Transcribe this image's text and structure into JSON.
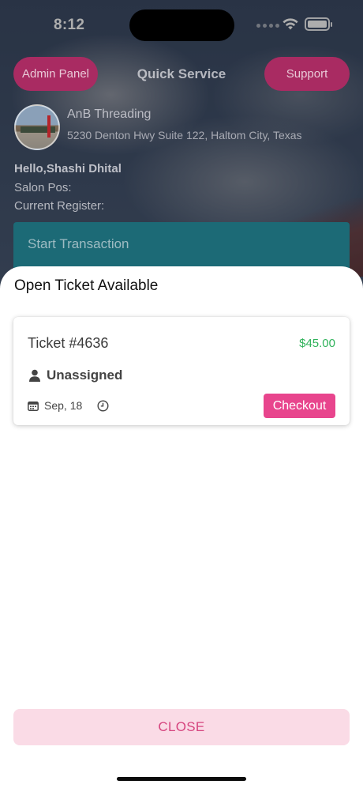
{
  "status_bar": {
    "time": "8:12"
  },
  "header": {
    "admin_label": "Admin Panel",
    "title": "Quick Service",
    "support_label": "Support"
  },
  "store": {
    "name": "AnB Threading",
    "address": "5230 Denton Hwy Suite 122, Haltom City, Texas"
  },
  "session": {
    "greeting": "Hello,Shashi Dhital",
    "salon_pos": "Salon Pos:",
    "current_register": "Current Register:"
  },
  "start_transaction_label": "Start Transaction",
  "sheet": {
    "title": "Open Ticket Available",
    "tickets": [
      {
        "number": "Ticket #4636",
        "amount": "$45.00",
        "assignee": "Unassigned",
        "date": "Sep, 18",
        "checkout_label": "Checkout"
      }
    ],
    "close_label": "CLOSE"
  },
  "colors": {
    "brand_pink": "#e8458d",
    "price_green": "#2fb25a",
    "teal": "#1c6a76",
    "close_bg": "#fadbe6"
  },
  "icons": [
    "person-icon",
    "calendar-icon",
    "clock-icon",
    "wifi-icon",
    "battery-icon"
  ]
}
